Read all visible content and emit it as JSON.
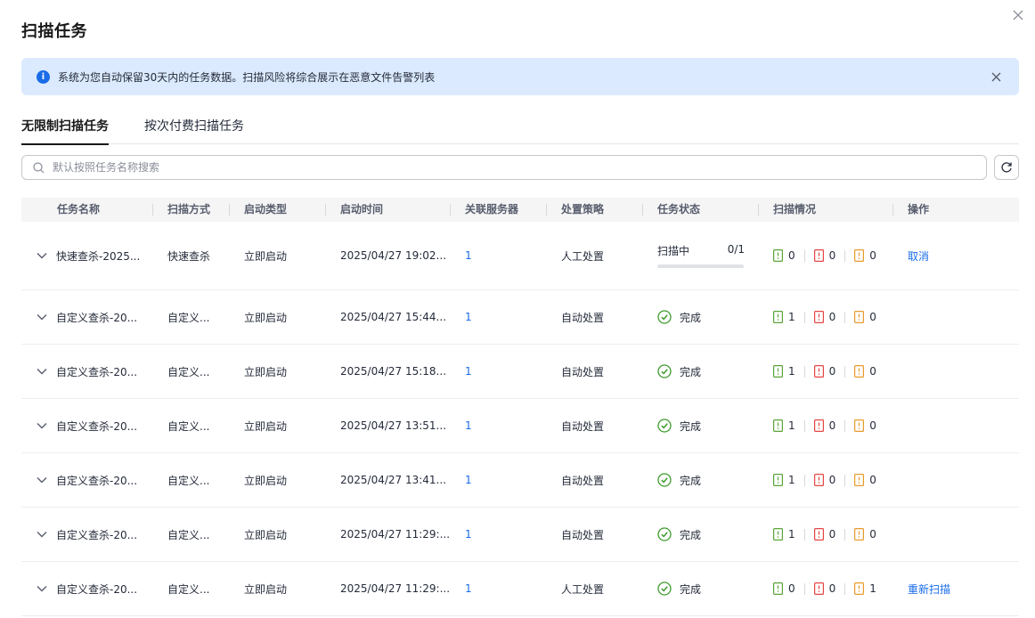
{
  "dialog": {
    "title": "扫描任务"
  },
  "alert": {
    "text": "系统为您自动保留30天内的任务数据。扫描风险将综合展示在恶意文件告警列表",
    "color": "#dbeafe"
  },
  "tabs": [
    {
      "label": "无限制扫描任务",
      "active": true
    },
    {
      "label": "按次付费扫描任务",
      "active": false
    }
  ],
  "search": {
    "placeholder": "默认按照任务名称搜索"
  },
  "table": {
    "columns": [
      "任务名称",
      "扫描方式",
      "启动类型",
      "启动时间",
      "关联服务器",
      "处置策略",
      "任务状态",
      "扫描情况",
      "操作"
    ],
    "rows": [
      {
        "name": "快速查杀-2025...",
        "method": "快速查杀",
        "start_type": "立即启动",
        "start_time": "2025/04/27 19:02...",
        "servers": "1",
        "policy": "人工处置",
        "status": "扫描中",
        "progress": "0/1",
        "progress_fraction": 0,
        "scan_green": "0",
        "scan_red": "0",
        "scan_orange": "0",
        "action": "取消"
      },
      {
        "name": "自定义查杀-20...",
        "method": "自定义...",
        "start_type": "立即启动",
        "start_time": "2025/04/27 15:44...",
        "servers": "1",
        "policy": "自动处置",
        "status": "完成",
        "scan_green": "1",
        "scan_red": "0",
        "scan_orange": "0",
        "action": ""
      },
      {
        "name": "自定义查杀-20...",
        "method": "自定义...",
        "start_type": "立即启动",
        "start_time": "2025/04/27 15:18...",
        "servers": "1",
        "policy": "自动处置",
        "status": "完成",
        "scan_green": "1",
        "scan_red": "0",
        "scan_orange": "0",
        "action": ""
      },
      {
        "name": "自定义查杀-20...",
        "method": "自定义...",
        "start_type": "立即启动",
        "start_time": "2025/04/27 13:51...",
        "servers": "1",
        "policy": "自动处置",
        "status": "完成",
        "scan_green": "1",
        "scan_red": "0",
        "scan_orange": "0",
        "action": ""
      },
      {
        "name": "自定义查杀-20...",
        "method": "自定义...",
        "start_type": "立即启动",
        "start_time": "2025/04/27 13:41...",
        "servers": "1",
        "policy": "自动处置",
        "status": "完成",
        "scan_green": "1",
        "scan_red": "0",
        "scan_orange": "0",
        "action": ""
      },
      {
        "name": "自定义查杀-20...",
        "method": "自定义...",
        "start_type": "立即启动",
        "start_time": "2025/04/27 11:29:...",
        "servers": "1",
        "policy": "自动处置",
        "status": "完成",
        "scan_green": "1",
        "scan_red": "0",
        "scan_orange": "0",
        "action": ""
      },
      {
        "name": "自定义查杀-20...",
        "method": "自定义...",
        "start_type": "立即启动",
        "start_time": "2025/04/27 11:29:...",
        "servers": "1",
        "policy": "人工处置",
        "status": "完成",
        "scan_green": "0",
        "scan_red": "0",
        "scan_orange": "1",
        "action": "重新扫描"
      }
    ]
  },
  "colors": {
    "link": "#1a6ce8",
    "done_green": "#3f9b2e",
    "scan_green": "#5ba53a",
    "scan_red": "#e54545",
    "scan_orange": "#e89b2c"
  },
  "icons": [
    "close-icon",
    "info-icon",
    "search-icon",
    "refresh-icon",
    "chevron-down-icon",
    "check-circle-icon",
    "file-icon"
  ]
}
